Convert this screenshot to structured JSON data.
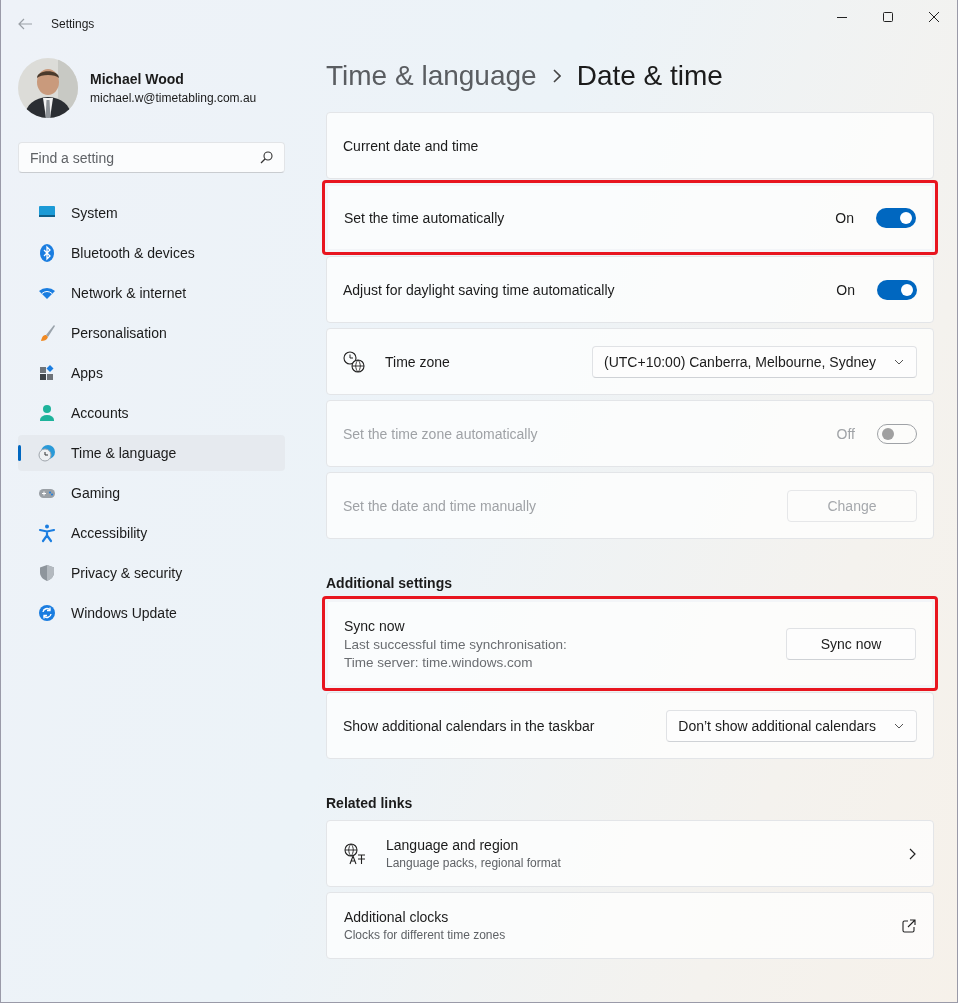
{
  "window": {
    "title": "Settings"
  },
  "profile": {
    "name": "Michael Wood",
    "email": "michael.w@timetabling.com.au"
  },
  "search": {
    "placeholder": "Find a setting"
  },
  "sidebar": {
    "items": [
      {
        "label": "System",
        "selected": false
      },
      {
        "label": "Bluetooth & devices",
        "selected": false
      },
      {
        "label": "Network & internet",
        "selected": false
      },
      {
        "label": "Personalisation",
        "selected": false
      },
      {
        "label": "Apps",
        "selected": false
      },
      {
        "label": "Accounts",
        "selected": false
      },
      {
        "label": "Time & language",
        "selected": true
      },
      {
        "label": "Gaming",
        "selected": false
      },
      {
        "label": "Accessibility",
        "selected": false
      },
      {
        "label": "Privacy & security",
        "selected": false
      },
      {
        "label": "Windows Update",
        "selected": false
      }
    ]
  },
  "breadcrumb": {
    "parent": "Time & language",
    "current": "Date & time"
  },
  "settings": [
    {
      "kind": "info",
      "label": "Current date and time",
      "disabled": false,
      "highlighted": false
    },
    {
      "kind": "toggle",
      "label": "Set the time automatically",
      "on": true,
      "state_text": "On",
      "disabled": false,
      "highlighted": true
    },
    {
      "kind": "toggle",
      "label": "Adjust for daylight saving time automatically",
      "on": true,
      "state_text": "On",
      "disabled": false,
      "highlighted": false
    },
    {
      "kind": "dropdown",
      "label": "Time zone",
      "value": "(UTC+10:00) Canberra, Melbourne, Sydney",
      "disabled": false,
      "highlighted": false
    },
    {
      "kind": "toggle",
      "label": "Set the time zone automatically",
      "on": false,
      "state_text": "Off",
      "disabled": true,
      "highlighted": false
    },
    {
      "kind": "button",
      "label": "Set the date and time manually",
      "button": "Change",
      "disabled": true,
      "highlighted": false
    }
  ],
  "additional_settings": {
    "heading": "Additional settings",
    "rows": [
      {
        "kind": "button",
        "label": "Sync now",
        "details": [
          "Last successful time synchronisation:",
          "Time server: time.windows.com"
        ],
        "button": "Sync now",
        "disabled": false,
        "highlighted": true
      },
      {
        "kind": "dropdown",
        "label": "Show additional calendars in the taskbar",
        "value": "Don’t show additional calendars",
        "disabled": false,
        "highlighted": false
      }
    ]
  },
  "related_links": {
    "heading": "Related links",
    "links": [
      {
        "kind": "page",
        "title": "Language and region",
        "subtitle": "Language packs, regional format"
      },
      {
        "kind": "external",
        "title": "Additional clocks",
        "subtitle": "Clocks for different time zones"
      }
    ]
  }
}
